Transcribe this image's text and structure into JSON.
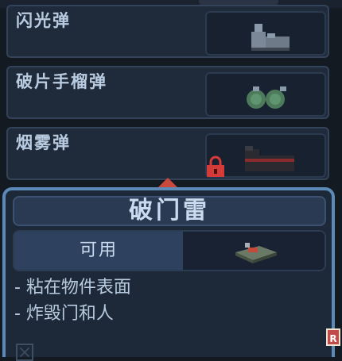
{
  "items": [
    {
      "name": "闪光弹",
      "icon": "flashbang-icon",
      "locked": false
    },
    {
      "name": "破片手榴弹",
      "icon": "frag-grenade-icon",
      "locked": false
    },
    {
      "name": "烟雾弹",
      "icon": "smoke-grenade-icon",
      "locked": true
    }
  ],
  "selected": {
    "title": "破门雷",
    "status": "可用",
    "icon": "breach-charge-icon",
    "description": [
      "- 粘在物件表面",
      "- 炸毁门和人"
    ]
  },
  "hints": {
    "r_key": "R"
  },
  "colors": {
    "accent": "#5b8ab8",
    "lock": "#d43a38",
    "arrow": "#c9493d"
  }
}
